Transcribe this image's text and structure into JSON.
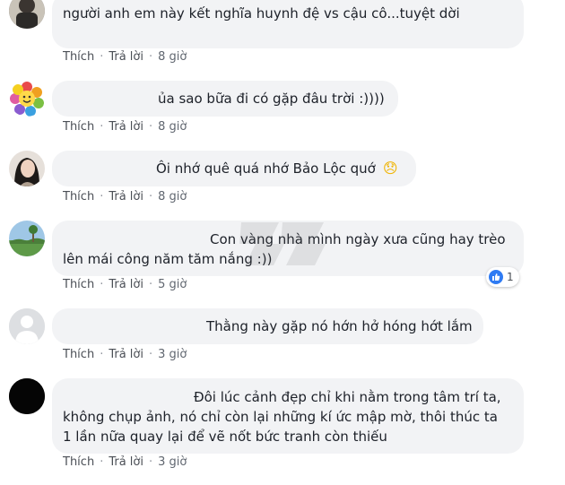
{
  "comments": [
    {
      "text": "người anh em này kết nghĩa huynh đệ vs cậu cô...tuyệt dời",
      "like": "Thích",
      "reply": "Trả lời",
      "dot": "·",
      "time": "8 giờ"
    },
    {
      "text": "ủa sao bữa đi có gặp đâu trời :))))",
      "like": "Thích",
      "reply": "Trả lời",
      "dot": "·",
      "time": "8 giờ"
    },
    {
      "text": "Ôi nhớ quê quá nhớ Bảo Lộc quớ",
      "emoji": "😞",
      "like": "Thích",
      "reply": "Trả lời",
      "dot": "·",
      "time": "8 giờ"
    },
    {
      "text": "Con vàng nhà mình ngày xưa cũng hay trèo lên mái công năm tăm nắng :))",
      "like": "Thích",
      "reply": "Trả lời",
      "dot": "·",
      "time": "5 giờ",
      "reaction_count": "1"
    },
    {
      "text": "Thằng này gặp nó hớn hở hóng hớt lắm",
      "like": "Thích",
      "reply": "Trả lời",
      "dot": "·",
      "time": "3 giờ"
    },
    {
      "text": "Đôi lúc cảnh đẹp chỉ khi nằm trong tâm trí ta, không chụp ảnh, nó chỉ còn lại những kí ức mập mờ, thôi thúc ta 1 lần nữa quay lại để vẽ nốt bức tranh còn thiếu",
      "like": "Thích",
      "reply": "Trả lời",
      "dot": "·",
      "time": "3 giờ"
    }
  ],
  "colors": {
    "bubble": "#f2f3f5",
    "like_blue": "#2f7bf3",
    "meta": "#616770"
  },
  "icons": {
    "reaction": "like-icon"
  }
}
